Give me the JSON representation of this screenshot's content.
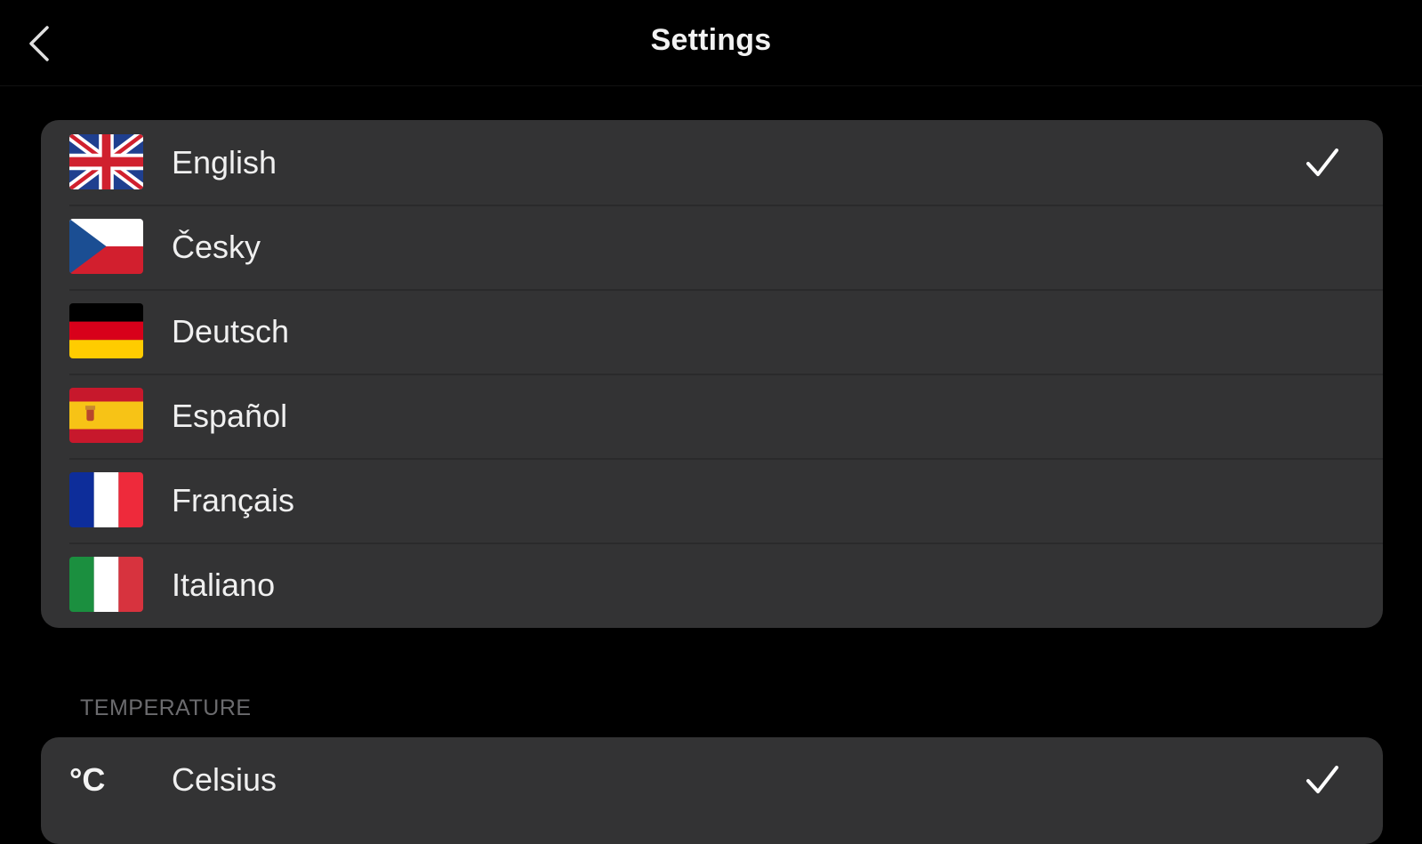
{
  "nav": {
    "title": "Settings",
    "back_icon": "chevron-left-icon"
  },
  "languages": {
    "items": [
      {
        "label": "English",
        "flag": "uk-flag-icon",
        "selected": true
      },
      {
        "label": "Česky",
        "flag": "czech-flag-icon",
        "selected": false
      },
      {
        "label": "Deutsch",
        "flag": "german-flag-icon",
        "selected": false
      },
      {
        "label": "Español",
        "flag": "spanish-flag-icon",
        "selected": false
      },
      {
        "label": "Français",
        "flag": "french-flag-icon",
        "selected": false
      },
      {
        "label": "Italiano",
        "flag": "italian-flag-icon",
        "selected": false
      }
    ]
  },
  "temperature": {
    "header": "TEMPERATURE",
    "items": [
      {
        "label": "Celsius",
        "symbol": "°C",
        "selected": true
      }
    ]
  },
  "colors": {
    "background": "#000000",
    "group_background": "#333334",
    "separator": "#2a2a2b",
    "section_header": "#6b6b6e",
    "text": "#f0f0f0"
  }
}
